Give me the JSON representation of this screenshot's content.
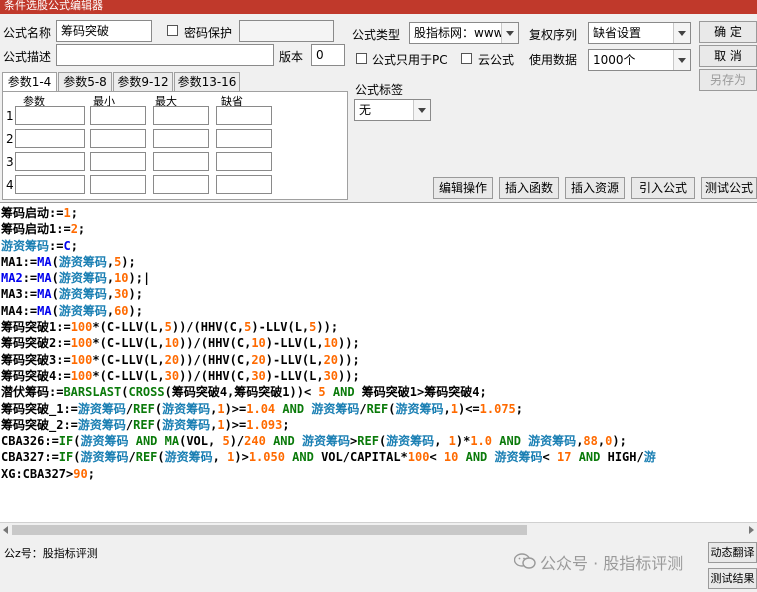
{
  "window": {
    "title": "条件选股公式编辑器"
  },
  "form": {
    "name_label": "公式名称",
    "name_value": "筹码突破",
    "password_label": "密码保护",
    "desc_label": "公式描述",
    "desc_value": "",
    "version_label": "版本",
    "version_value": "0",
    "type_label": "公式类型",
    "type_value": "股指标网：www",
    "rights_label": "复权序列",
    "rights_value": "缺省设置",
    "pc_only_label": "公式只用于PC",
    "cloud_label": "云公式",
    "data_label": "使用数据",
    "data_value": "1000个",
    "tag_label": "公式标签",
    "tag_value": "无"
  },
  "buttons": {
    "ok": "确 定",
    "cancel": "取 消",
    "save_as": "另存为",
    "edit_ops": "编辑操作",
    "insert_func": "插入函数",
    "insert_res": "插入资源",
    "import_formula": "引入公式",
    "test_formula": "测试公式",
    "dyn_translate": "动态翻译",
    "test_result": "测试结果"
  },
  "params": {
    "tabs": [
      "参数1-4",
      "参数5-8",
      "参数9-12",
      "参数13-16"
    ],
    "headers": [
      "参数",
      "最小",
      "最大",
      "缺省"
    ],
    "rows": [
      "1",
      "2",
      "3",
      "4"
    ]
  },
  "code_lines": [
    [
      [
        "k",
        "筹码启动:="
      ],
      [
        "num",
        "1"
      ],
      [
        "k",
        ";"
      ]
    ],
    [
      [
        "k",
        "筹码启动1:="
      ],
      [
        "num",
        "2"
      ],
      [
        "k",
        ";"
      ]
    ],
    [
      [
        "var",
        "游资筹码"
      ],
      [
        "k",
        ":="
      ],
      [
        "fn",
        "C"
      ],
      [
        "k",
        ";"
      ]
    ],
    [
      [
        "k",
        "MA1:="
      ],
      [
        "fn",
        "MA"
      ],
      [
        "k",
        "("
      ],
      [
        "var",
        "游资筹码"
      ],
      [
        "k",
        ","
      ],
      [
        "num",
        "5"
      ],
      [
        "k",
        ");"
      ]
    ],
    [
      [
        "fn",
        "MA2"
      ],
      [
        "k",
        ":="
      ],
      [
        "fn",
        "MA"
      ],
      [
        "k",
        "("
      ],
      [
        "var",
        "游资筹码"
      ],
      [
        "k",
        ","
      ],
      [
        "num",
        "10"
      ],
      [
        "k",
        ");|"
      ]
    ],
    [
      [
        "k",
        "MA3:="
      ],
      [
        "fn",
        "MA"
      ],
      [
        "k",
        "("
      ],
      [
        "var",
        "游资筹码"
      ],
      [
        "k",
        ","
      ],
      [
        "num",
        "30"
      ],
      [
        "k",
        ");"
      ]
    ],
    [
      [
        "k",
        "MA4:="
      ],
      [
        "fn",
        "MA"
      ],
      [
        "k",
        "("
      ],
      [
        "var",
        "游资筹码"
      ],
      [
        "k",
        ","
      ],
      [
        "num",
        "60"
      ],
      [
        "k",
        ");"
      ]
    ],
    [
      [
        "k",
        "筹码突破1:="
      ],
      [
        "num",
        "100"
      ],
      [
        "k",
        "*(C-LLV(L,"
      ],
      [
        "num",
        "5"
      ],
      [
        "k",
        "))/(HHV(C,"
      ],
      [
        "num",
        "5"
      ],
      [
        "k",
        ")-LLV(L,"
      ],
      [
        "num",
        "5"
      ],
      [
        "k",
        "));"
      ]
    ],
    [
      [
        "k",
        "筹码突破2:="
      ],
      [
        "num",
        "100"
      ],
      [
        "k",
        "*(C-LLV(L,"
      ],
      [
        "num",
        "10"
      ],
      [
        "k",
        "))/(HHV(C,"
      ],
      [
        "num",
        "10"
      ],
      [
        "k",
        ")-LLV(L,"
      ],
      [
        "num",
        "10"
      ],
      [
        "k",
        "));"
      ]
    ],
    [
      [
        "k",
        "筹码突破3:="
      ],
      [
        "num",
        "100"
      ],
      [
        "k",
        "*(C-LLV(L,"
      ],
      [
        "num",
        "20"
      ],
      [
        "k",
        "))/(HHV(C,"
      ],
      [
        "num",
        "20"
      ],
      [
        "k",
        ")-LLV(L,"
      ],
      [
        "num",
        "20"
      ],
      [
        "k",
        "));"
      ]
    ],
    [
      [
        "k",
        "筹码突破4:="
      ],
      [
        "num",
        "100"
      ],
      [
        "k",
        "*(C-LLV(L,"
      ],
      [
        "num",
        "30"
      ],
      [
        "k",
        "))/(HHV(C,"
      ],
      [
        "num",
        "30"
      ],
      [
        "k",
        ")-LLV(L,"
      ],
      [
        "num",
        "30"
      ],
      [
        "k",
        "));"
      ]
    ],
    [
      [
        "k",
        "潜伏筹码:="
      ],
      [
        "op",
        "BARSLAST"
      ],
      [
        "k",
        "("
      ],
      [
        "op",
        "CROSS"
      ],
      [
        "k",
        "(筹码突破4,筹码突破1))< "
      ],
      [
        "num",
        "5"
      ],
      [
        "k",
        " "
      ],
      [
        "op",
        "AND"
      ],
      [
        "k",
        " 筹码突破1>筹码突破4;"
      ]
    ],
    [
      [
        "k",
        "筹码突破_1:="
      ],
      [
        "var",
        "游资筹码"
      ],
      [
        "k",
        "/"
      ],
      [
        "op",
        "REF"
      ],
      [
        "k",
        "("
      ],
      [
        "var",
        "游资筹码"
      ],
      [
        "k",
        ","
      ],
      [
        "num",
        "1"
      ],
      [
        "k",
        ")>="
      ],
      [
        "num",
        "1.04"
      ],
      [
        "k",
        " "
      ],
      [
        "op",
        "AND"
      ],
      [
        "k",
        " "
      ],
      [
        "var",
        "游资筹码"
      ],
      [
        "k",
        "/"
      ],
      [
        "op",
        "REF"
      ],
      [
        "k",
        "("
      ],
      [
        "var",
        "游资筹码"
      ],
      [
        "k",
        ","
      ],
      [
        "num",
        "1"
      ],
      [
        "k",
        ")<="
      ],
      [
        "num",
        "1.075"
      ],
      [
        "k",
        ";"
      ]
    ],
    [
      [
        "k",
        "筹码突破_2:="
      ],
      [
        "var",
        "游资筹码"
      ],
      [
        "k",
        "/"
      ],
      [
        "op",
        "REF"
      ],
      [
        "k",
        "("
      ],
      [
        "var",
        "游资筹码"
      ],
      [
        "k",
        ","
      ],
      [
        "num",
        "1"
      ],
      [
        "k",
        ")>="
      ],
      [
        "num",
        "1.093"
      ],
      [
        "k",
        ";"
      ]
    ],
    [
      [
        "k",
        "CBA326:="
      ],
      [
        "op",
        "IF"
      ],
      [
        "k",
        "("
      ],
      [
        "var",
        "游资筹码"
      ],
      [
        "k",
        " "
      ],
      [
        "op",
        "AND"
      ],
      [
        "k",
        " "
      ],
      [
        "op",
        "MA"
      ],
      [
        "k",
        "(VOL, "
      ],
      [
        "num",
        "5"
      ],
      [
        "k",
        ")/"
      ],
      [
        "num",
        "240"
      ],
      [
        "k",
        " "
      ],
      [
        "op",
        "AND"
      ],
      [
        "k",
        " "
      ],
      [
        "var",
        "游资筹码"
      ],
      [
        "k",
        ">"
      ],
      [
        "op",
        "REF"
      ],
      [
        "k",
        "("
      ],
      [
        "var",
        "游资筹码"
      ],
      [
        "k",
        ", "
      ],
      [
        "num",
        "1"
      ],
      [
        "k",
        ")*"
      ],
      [
        "num",
        "1.0"
      ],
      [
        "k",
        " "
      ],
      [
        "op",
        "AND"
      ],
      [
        "k",
        " "
      ],
      [
        "var",
        "游资筹码"
      ],
      [
        "k",
        ","
      ],
      [
        "num",
        "88"
      ],
      [
        "k",
        ","
      ],
      [
        "num",
        "0"
      ],
      [
        "k",
        ");"
      ]
    ],
    [
      [
        "k",
        "CBA327:="
      ],
      [
        "op",
        "IF"
      ],
      [
        "k",
        "("
      ],
      [
        "var",
        "游资筹码"
      ],
      [
        "k",
        "/"
      ],
      [
        "op",
        "REF"
      ],
      [
        "k",
        "("
      ],
      [
        "var",
        "游资筹码"
      ],
      [
        "k",
        ", "
      ],
      [
        "num",
        "1"
      ],
      [
        "k",
        ")>"
      ],
      [
        "num",
        "1.050"
      ],
      [
        "k",
        " "
      ],
      [
        "op",
        "AND"
      ],
      [
        "k",
        " VOL/CAPITAL*"
      ],
      [
        "num",
        "100"
      ],
      [
        "k",
        "< "
      ],
      [
        "num",
        "10"
      ],
      [
        "k",
        " "
      ],
      [
        "op",
        "AND"
      ],
      [
        "k",
        " "
      ],
      [
        "var",
        "游资筹码"
      ],
      [
        "k",
        "< "
      ],
      [
        "num",
        "17"
      ],
      [
        "k",
        " "
      ],
      [
        "op",
        "AND"
      ],
      [
        "k",
        " HIGH/"
      ],
      [
        "var",
        "游"
      ]
    ],
    [
      [
        "k",
        "XG:CBA327>"
      ],
      [
        "num",
        "90"
      ],
      [
        "k",
        ";"
      ]
    ]
  ],
  "status": {
    "text": "公z号：股指标评测"
  },
  "watermark": {
    "text": "公众号 · 股指标评测"
  },
  "colors": {
    "title_bar": "#c0392b",
    "number": "#ff6a00",
    "variable": "#1a7fb3",
    "function": "#0000ee",
    "operator": "#0a7a0a"
  }
}
